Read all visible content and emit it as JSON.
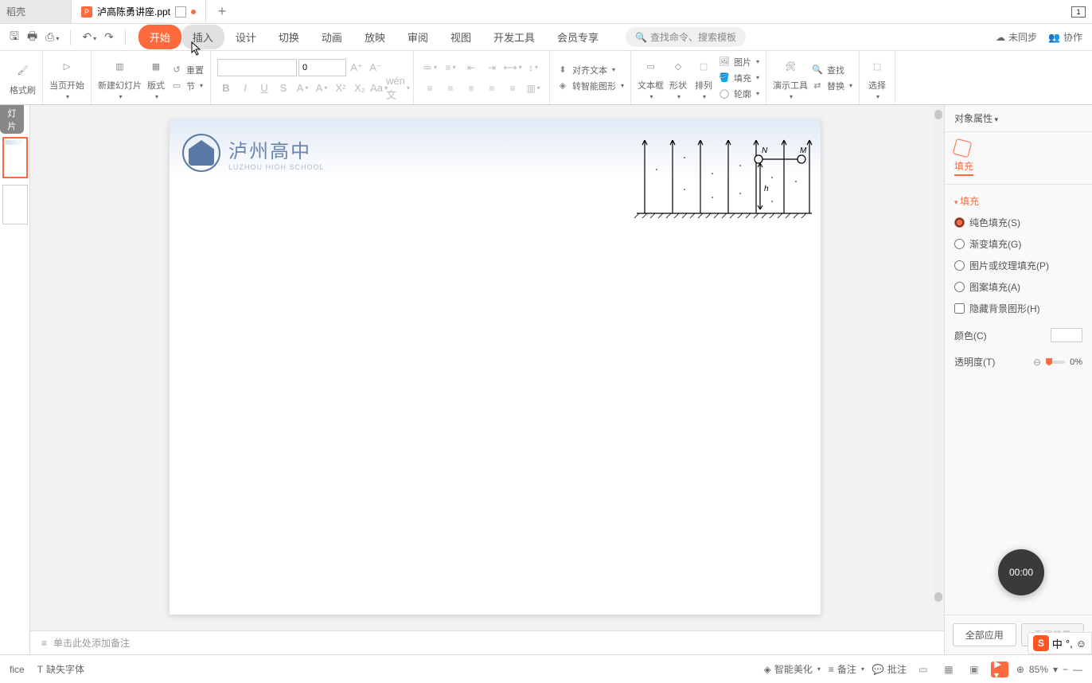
{
  "tabs": {
    "left_label": "稻壳",
    "file_name": "泸高陈勇讲座.ppt"
  },
  "top_right": {
    "indicator": "1"
  },
  "qat": {
    "undo": "↶",
    "redo": "↷"
  },
  "menu": {
    "items": [
      "开始",
      "插入",
      "设计",
      "切换",
      "动画",
      "放映",
      "审阅",
      "视图",
      "开发工具",
      "会员专享"
    ],
    "active_index": 0,
    "hover_index": 1,
    "search_placeholder": "查找命令、搜索模板",
    "right": {
      "unsync": "未同步",
      "collab": "协作"
    }
  },
  "ribbon": {
    "format_painter": "格式刷",
    "from_current": "当页开始",
    "new_slide": "新建幻灯片",
    "layout": "版式",
    "section": "节",
    "reset": "重置",
    "font_size": "0",
    "textbox": "文本框",
    "shape": "形状",
    "arrange": "排列",
    "picture": "图片",
    "fill": "填充",
    "outline": "轮廓",
    "align_text": "对齐文本",
    "convert_smart": "转智能图形",
    "present_tools": "演示工具",
    "find": "查找",
    "replace": "替换",
    "select": "选择"
  },
  "slide": {
    "school_name": "泸州高中",
    "school_sub": "LUZHOU HIGH SCHOOL",
    "diagram": {
      "label_n": "N",
      "label_m": "M",
      "label_h": "h"
    }
  },
  "panel": {
    "title": "对象属性",
    "mode": "填充",
    "section": "填充",
    "options": {
      "solid": "纯色填充(S)",
      "gradient": "渐变填充(G)",
      "picture": "图片或纹理填充(P)",
      "pattern": "图案填充(A)",
      "hide_bg": "隐藏背景图形(H)"
    },
    "color_label": "颜色(C)",
    "opacity_label": "透明度(T)",
    "opacity_value": "0%",
    "apply_all": "全部应用",
    "reset_bg": "重置背景"
  },
  "notes": {
    "placeholder": "单击此处添加备注"
  },
  "status": {
    "office": "fice",
    "missing_font": "缺失字体",
    "beautify": "智能美化",
    "notes": "备注",
    "comments": "批注",
    "zoom": "85%"
  },
  "record": {
    "time": "00:00"
  },
  "ime": {
    "lang": "中",
    "punct": "°,",
    "face": "☺"
  }
}
